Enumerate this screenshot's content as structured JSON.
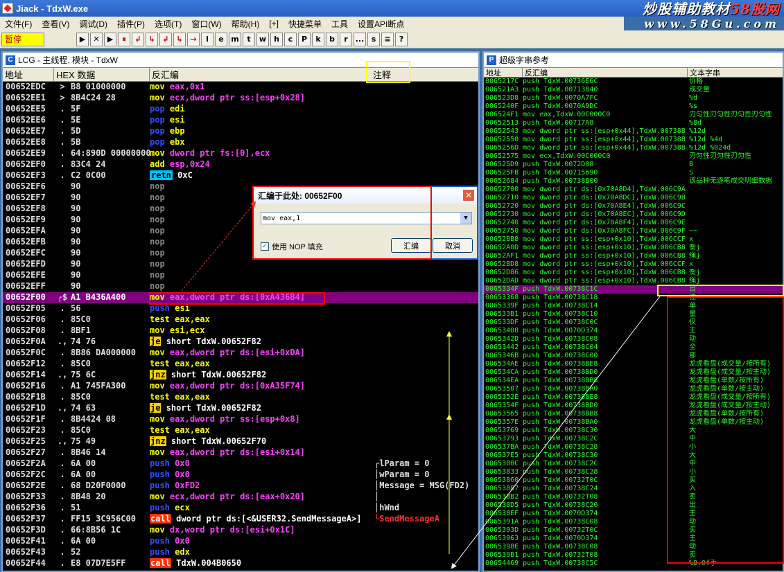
{
  "window": {
    "title": "Jiack   - TdxW.exe"
  },
  "watermark": {
    "line1": "炒股辅助教材",
    "line1_red": "58股网",
    "line2": "www.58Gu.com"
  },
  "menu": [
    "文件(F)",
    "查看(V)",
    "调试(D)",
    "插件(P)",
    "选项(T)",
    "窗口(W)",
    "帮助(H)",
    "[+]",
    "快捷菜单",
    "工具",
    "设置API断点"
  ],
  "toolbar": {
    "status": "暂停",
    "buttons": [
      "▶",
      "✕",
      "▶",
      "⏸",
      "↲",
      "↳",
      "↲",
      "↳",
      "→",
      "l",
      "e",
      "m",
      "t",
      "w",
      "h",
      "c",
      "P",
      "k",
      "b",
      "r",
      "...",
      "s",
      "≡",
      "?"
    ]
  },
  "cpu": {
    "title": "LCG - 主线程, 模块 - TdxW",
    "headers": {
      "addr": "地址",
      "hex": "HEX 数据",
      "dis": "反汇编",
      "cmt": "注释"
    },
    "rows": [
      {
        "a": "00652EDC",
        "m": ">",
        "h": "B8 01000000",
        "op": "mov",
        "opc": "k-mov",
        "args": "eax,0x1"
      },
      {
        "a": "00652EE1",
        "m": ">",
        "h": "8B4C24 28",
        "op": "mov",
        "opc": "k-mov",
        "args": "ecx,dword ptr ss:[esp+0x28]"
      },
      {
        "a": "00652EE5",
        "m": ".",
        "h": "5F",
        "op": "pop",
        "opc": "k-pop",
        "args": "edi"
      },
      {
        "a": "00652EE6",
        "m": ".",
        "h": "5E",
        "op": "pop",
        "opc": "k-pop",
        "args": "esi"
      },
      {
        "a": "00652EE7",
        "m": ".",
        "h": "5D",
        "op": "pop",
        "opc": "k-pop",
        "args": "ebp"
      },
      {
        "a": "00652EE8",
        "m": ".",
        "h": "5B",
        "op": "pop",
        "opc": "k-pop",
        "args": "ebx"
      },
      {
        "a": "00652EE9",
        "m": ".",
        "h": "64:890D 00000000",
        "op": "mov",
        "opc": "k-mov",
        "args": "dword ptr fs:[0],ecx"
      },
      {
        "a": "00652EF0",
        "m": ".",
        "h": "83C4 24",
        "op": "add",
        "opc": "k-add",
        "args": "esp,0x24"
      },
      {
        "a": "00652EF3",
        "m": ".",
        "h": "C2 0C00",
        "op": "retn",
        "opc": "k-retn",
        "args": "0xC"
      },
      {
        "a": "00652EF6",
        "m": "",
        "h": "90",
        "op": "nop",
        "opc": "k-nop",
        "args": ""
      },
      {
        "a": "00652EF7",
        "m": "",
        "h": "90",
        "op": "nop",
        "opc": "k-nop",
        "args": ""
      },
      {
        "a": "00652EF8",
        "m": "",
        "h": "90",
        "op": "nop",
        "opc": "k-nop",
        "args": ""
      },
      {
        "a": "00652EF9",
        "m": "",
        "h": "90",
        "op": "nop",
        "opc": "k-nop",
        "args": ""
      },
      {
        "a": "00652EFA",
        "m": "",
        "h": "90",
        "op": "nop",
        "opc": "k-nop",
        "args": ""
      },
      {
        "a": "00652EFB",
        "m": "",
        "h": "90",
        "op": "nop",
        "opc": "k-nop",
        "args": ""
      },
      {
        "a": "00652EFC",
        "m": "",
        "h": "90",
        "op": "nop",
        "opc": "k-nop",
        "args": ""
      },
      {
        "a": "00652EFD",
        "m": "",
        "h": "90",
        "op": "nop",
        "opc": "k-nop",
        "args": ""
      },
      {
        "a": "00652EFE",
        "m": "",
        "h": "90",
        "op": "nop",
        "opc": "k-nop",
        "args": ""
      },
      {
        "a": "00652EFF",
        "m": "",
        "h": "90",
        "op": "nop",
        "opc": "k-nop",
        "args": ""
      },
      {
        "a": "00652F00",
        "m": "┌$",
        "h": "A1 B436A400",
        "op": "mov",
        "opc": "k-mov",
        "args": "eax,dword ptr ds:[0xA436B4]",
        "sel": true
      },
      {
        "a": "00652F05",
        "m": ".",
        "h": "56",
        "op": "push",
        "opc": "k-push",
        "args": "esi"
      },
      {
        "a": "00652F06",
        "m": ".",
        "h": "85C0",
        "op": "test",
        "opc": "k-test",
        "args": "eax,eax"
      },
      {
        "a": "00652F08",
        "m": ".",
        "h": "8BF1",
        "op": "mov",
        "opc": "k-mov",
        "args": "esi,ecx"
      },
      {
        "a": "00652F0A",
        "m": ".,",
        "h": "74 76",
        "op": "je",
        "opc": "k-jmp",
        "args": "short TdxW.00652F82"
      },
      {
        "a": "00652F0C",
        "m": ".",
        "h": "8B86 DA000000",
        "op": "mov",
        "opc": "k-mov",
        "args": "eax,dword ptr ds:[esi+0xDA]"
      },
      {
        "a": "00652F12",
        "m": ".",
        "h": "85C0",
        "op": "test",
        "opc": "k-test",
        "args": "eax,eax"
      },
      {
        "a": "00652F14",
        "m": ".,",
        "h": "75 6C",
        "op": "jnz",
        "opc": "k-jmp",
        "args": "short TdxW.00652F82"
      },
      {
        "a": "00652F16",
        "m": ".",
        "h": "A1 745FA300",
        "op": "mov",
        "opc": "k-mov",
        "args": "eax,dword ptr ds:[0xA35F74]"
      },
      {
        "a": "00652F1B",
        "m": ".",
        "h": "85C0",
        "op": "test",
        "opc": "k-test",
        "args": "eax,eax"
      },
      {
        "a": "00652F1D",
        "m": ".,",
        "h": "74 63",
        "op": "je",
        "opc": "k-jmp",
        "args": "short TdxW.00652F82"
      },
      {
        "a": "00652F1F",
        "m": ".",
        "h": "8B4424 08",
        "op": "mov",
        "opc": "k-mov",
        "args": "eax,dword ptr ss:[esp+0x8]"
      },
      {
        "a": "00652F23",
        "m": ".",
        "h": "85C0",
        "op": "test",
        "opc": "k-test",
        "args": "eax,eax"
      },
      {
        "a": "00652F25",
        "m": ".,",
        "h": "75 49",
        "op": "jnz",
        "opc": "k-jmp",
        "args": "short TdxW.00652F70"
      },
      {
        "a": "00652F27",
        "m": ".",
        "h": "8B46 14",
        "op": "mov",
        "opc": "k-mov",
        "args": "eax,dword ptr ds:[esi+0x14]"
      },
      {
        "a": "00652F2A",
        "m": ".",
        "h": "6A 00",
        "op": "push",
        "opc": "k-push",
        "args": "0x0",
        "cmt": "┌lParam = 0"
      },
      {
        "a": "00652F2C",
        "m": ".",
        "h": "6A 00",
        "op": "push",
        "opc": "k-push",
        "args": "0x0",
        "cmt": "│wParam = 0"
      },
      {
        "a": "00652F2E",
        "m": ".",
        "h": "68 D20F0000",
        "op": "push",
        "opc": "k-push",
        "args": "0xFD2",
        "cmt": "│Message = MSG(FD2)"
      },
      {
        "a": "00652F33",
        "m": ".",
        "h": "8B48 20",
        "op": "mov",
        "opc": "k-mov",
        "args": "ecx,dword ptr ds:[eax+0x20]",
        "cmt": "│"
      },
      {
        "a": "00652F36",
        "m": ".",
        "h": "51",
        "op": "push",
        "opc": "k-push",
        "args": "ecx",
        "cmt": "│hWnd"
      },
      {
        "a": "00652F37",
        "m": ".",
        "h": "FF15 3C956C00",
        "op": "call",
        "opc": "k-call",
        "args": "dword ptr ds:[<&USER32.SendMessageA>]",
        "cmt": "└SendMessageA",
        "cmtc": "#ff3030"
      },
      {
        "a": "00652F3D",
        "m": ".",
        "h": "66:8B56 1C",
        "op": "mov",
        "opc": "k-mov",
        "args": "dx,word ptr ds:[esi+0x1C]"
      },
      {
        "a": "00652F41",
        "m": ".",
        "h": "6A 00",
        "op": "push",
        "opc": "k-push",
        "args": "0x0"
      },
      {
        "a": "00652F43",
        "m": ".",
        "h": "52",
        "op": "push",
        "opc": "k-push",
        "args": "edx"
      },
      {
        "a": "00652F44",
        "m": ".",
        "h": "E8 07D7E5FF",
        "op": "call",
        "opc": "k-call",
        "args": "TdxW.004B0650"
      }
    ]
  },
  "strings": {
    "title": "超级字串参考",
    "headers": {
      "addr": "地址",
      "dis": "反汇编",
      "text": "文本字串"
    },
    "rows": [
      {
        "a": "0065217C",
        "d": "push TdxW.00736E6C",
        "t": "价格"
      },
      {
        "a": "006521A3",
        "d": "push TdxW.00713840",
        "t": "成交量"
      },
      {
        "a": "006523D8",
        "d": "push TdxW.0070A7FC",
        "t": "%d"
      },
      {
        "a": "0065240F",
        "d": "push TdxW.0070A9DC",
        "t": "%s"
      },
      {
        "a": "006524F1",
        "d": "mov eax,TdxW.00C000C0",
        "t": "刃匀性刃匀性刃匀性刃匀性"
      },
      {
        "a": "00652513",
        "d": "push TdxW.00717A8",
        "t": "%8d"
      },
      {
        "a": "00652543",
        "d": "mov dword ptr ss:[esp+0x44],TdxW.00738B",
        "t": "%12d"
      },
      {
        "a": "00652550",
        "d": "mov dword ptr ss:[esp+0x44],TdxW.00738B",
        "t": "%12d %4d"
      },
      {
        "a": "0065256D",
        "d": "mov dword ptr ss:[esp+0x44],TdxW.00738B",
        "t": "%12d %024d"
      },
      {
        "a": "00652575",
        "d": "mov ecx,TdxW.00C000C0",
        "t": "刃匀性刃匀性刃匀性"
      },
      {
        "a": "006525D9",
        "d": "push TdxW.0072D08",
        "t": "B"
      },
      {
        "a": "006525FB",
        "d": "push TdxW.00715690",
        "t": "S"
      },
      {
        "a": "00652684",
        "d": "push TdxW.00738B00",
        "t": "该品种无逐笔成交明细数据"
      },
      {
        "a": "00652700",
        "d": "mov dword ptr ds:[0x70A8D4],TdxW.006C9A",
        "t": ""
      },
      {
        "a": "00652710",
        "d": "mov dword ptr ds:[0x70A8DC],TdxW.006C9B",
        "t": ""
      },
      {
        "a": "00652720",
        "d": "mov dword ptr ds:[0x70A8E4],TdxW.006C9C",
        "t": ""
      },
      {
        "a": "00652730",
        "d": "mov dword ptr ds:[0x70A8EC],TdxW.006C9D",
        "t": ""
      },
      {
        "a": "00652740",
        "d": "mov dword ptr ds:[0x70A8F4],TdxW.006C9E",
        "t": ""
      },
      {
        "a": "00652750",
        "d": "mov dword ptr ds:[0x70A8FC],TdxW.006C9F",
        "t": "~~"
      },
      {
        "a": "00652BB8",
        "d": "mov dword ptr ss:[esp+0x10],TdxW.006CCF",
        "t": "x"
      },
      {
        "a": "00652A0D",
        "d": "mov dword ptr ss:[esp+0x10],TdxW.006CB8",
        "t": "衡j"
      },
      {
        "a": "00652AF1",
        "d": "mov dword ptr ss:[esp+0x10],TdxW.006CB8",
        "t": "绳j"
      },
      {
        "a": "00652BD8",
        "d": "mov dword ptr ss:[esp+0x10],TdxW.006CCF",
        "t": "x"
      },
      {
        "a": "00652D86",
        "d": "mov dword ptr ss:[esp+0x10],TdxW.006CB8",
        "t": "衡j"
      },
      {
        "a": "00652DAD",
        "d": "mov dword ptr ss:[esp+0x10],TdxW.006CB8",
        "t": "绳j"
      },
      {
        "a": "0065334F",
        "d": "push TdxW.00738C1C",
        "t": "自",
        "sel": true
      },
      {
        "a": "00653368",
        "d": "push TdxW.00738C18",
        "t": "往"
      },
      {
        "a": "0065339F",
        "d": "push TdxW.00738C14",
        "t": "单"
      },
      {
        "a": "006533B1",
        "d": "push TdxW.00738C10",
        "t": "量"
      },
      {
        "a": "006533DF",
        "d": "push TdxW.00738C0C",
        "t": "仅"
      },
      {
        "a": "00653408",
        "d": "push TdxW.0070D374",
        "t": "主"
      },
      {
        "a": "0065342D",
        "d": "push TdxW.00738C08",
        "t": "动"
      },
      {
        "a": "00653442",
        "d": "push TdxW.00738C04",
        "t": "全"
      },
      {
        "a": "0065346B",
        "d": "push TdxW.00738C00",
        "t": "部"
      },
      {
        "a": "006534AE",
        "d": "push TdxW.00738BE8",
        "t": "龙虎看盘(成交量/按所有)"
      },
      {
        "a": "006534CA",
        "d": "push TdxW.00738BD0",
        "t": "龙虎看盘(成交量/按主动)"
      },
      {
        "a": "006534EA",
        "d": "push TdxW.00738BB8",
        "t": "龙虎看盘(单数/按所有)"
      },
      {
        "a": "00653507",
        "d": "push TdxW.00738BA0",
        "t": "龙虎看盘(单数/按主动)"
      },
      {
        "a": "0065352E",
        "d": "push TdxW.00738BE8",
        "t": "龙虎看盘(成交量/按所有)"
      },
      {
        "a": "0065354F",
        "d": "push TdxW.00738BD0",
        "t": "龙虎看盘(成交量/按主动)"
      },
      {
        "a": "00653565",
        "d": "push TdxW.00738BB8",
        "t": "龙虎看盘(单数/按所有)"
      },
      {
        "a": "0065357E",
        "d": "push TdxW.00738BA0",
        "t": "龙虎看盘(单数/按主动)"
      },
      {
        "a": "00653769",
        "d": "push TdxW.00738C30",
        "t": "大"
      },
      {
        "a": "00653793",
        "d": "push TdxW.00738C2C",
        "t": "中"
      },
      {
        "a": "006537BA",
        "d": "push TdxW.00738C28",
        "t": "小"
      },
      {
        "a": "006537E5",
        "d": "push TdxW.00738C30",
        "t": "大"
      },
      {
        "a": "0065380C",
        "d": "push TdxW.00738C2C",
        "t": "中"
      },
      {
        "a": "00653833",
        "d": "push TdxW.00738C28",
        "t": "小"
      },
      {
        "a": "00653860",
        "d": "push TdxW.00732T0C",
        "t": "买"
      },
      {
        "a": "00653887",
        "d": "push TdxW.00738C24",
        "t": "入"
      },
      {
        "a": "006538B2",
        "d": "push TdxW.00732T08",
        "t": "卖"
      },
      {
        "a": "006538D5",
        "d": "push TdxW.00738C20",
        "t": "出"
      },
      {
        "a": "006538EF",
        "d": "push TdxW.0070D374",
        "t": "主"
      },
      {
        "a": "0065391A",
        "d": "push TdxW.00738C08",
        "t": "动"
      },
      {
        "a": "0065393D",
        "d": "push TdxW.00732T0C",
        "t": "买"
      },
      {
        "a": "00653963",
        "d": "push TdxW.0070D374",
        "t": "主"
      },
      {
        "a": "0065398E",
        "d": "push TdxW.00738C08",
        "t": "动"
      },
      {
        "a": "006539B1",
        "d": "push TdxW.00732T08",
        "t": "卖"
      },
      {
        "a": "00654469",
        "d": "push TdxW.00738C5C",
        "t": "%8.0f手"
      }
    ]
  },
  "dialog": {
    "title": "汇编于此处: 00652F00",
    "input_value": "mov eax,1",
    "checkbox_label": "使用 NOP 填充",
    "checkbox_mark": "✓",
    "assemble_label": "汇编",
    "cancel_label": "取消",
    "close_glyph": "✕"
  }
}
